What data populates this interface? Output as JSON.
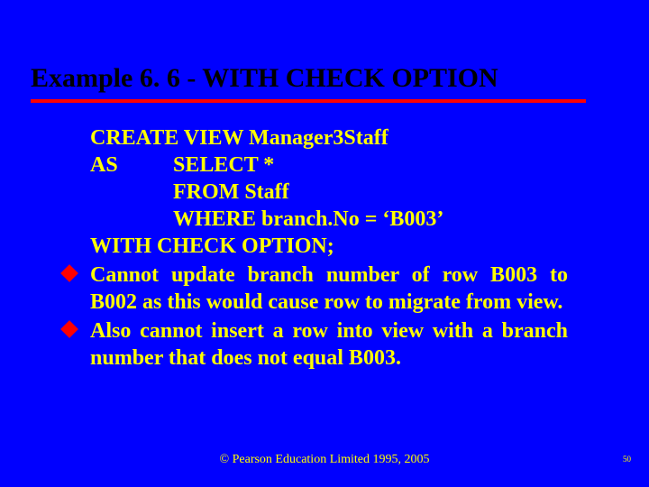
{
  "title": "Example 6. 6 - WITH CHECK OPTION",
  "sql": {
    "l1": "CREATE VIEW Manager3Staff",
    "l2a": "AS",
    "l2b": "SELECT *",
    "l3": "FROM Staff",
    "l4": "WHERE branch.No = ‘B003’",
    "l5": "WITH CHECK OPTION;"
  },
  "bullets": [
    "Cannot update branch number of row B003 to B002 as this would cause row to migrate from view.",
    "Also cannot insert a row into view with a branch number that does not equal B003."
  ],
  "footer": "© Pearson Education Limited 1995, 2005",
  "page": "50"
}
